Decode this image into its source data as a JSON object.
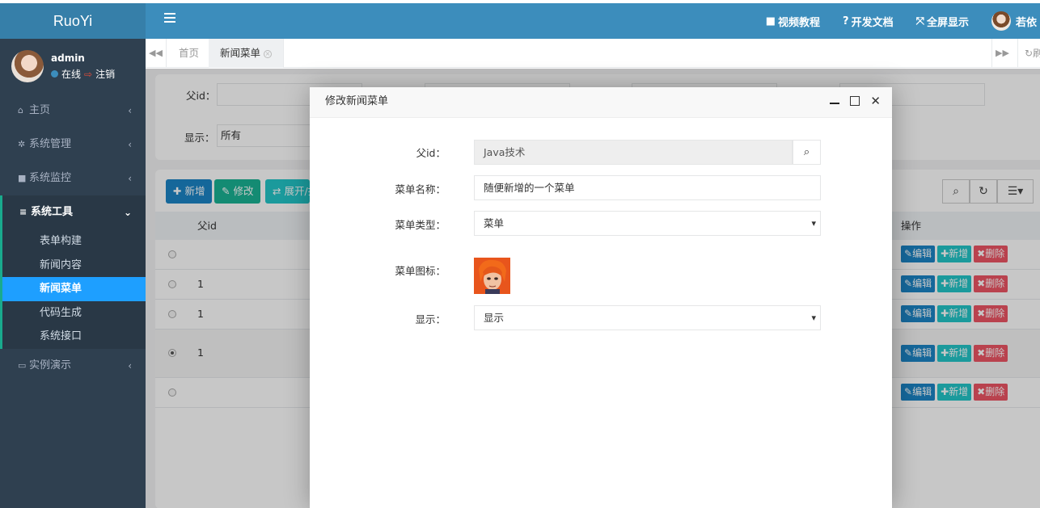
{
  "app": {
    "logo": "RuoYi"
  },
  "user": {
    "name": "admin",
    "status": "在线",
    "logout": "注销"
  },
  "sidebar": {
    "items": [
      {
        "icon": "home-icon",
        "label": "主页"
      },
      {
        "icon": "gear-icon",
        "label": "系统管理"
      },
      {
        "icon": "video-icon",
        "label": "系统监控"
      },
      {
        "icon": "list-icon",
        "label": "系统工具"
      },
      {
        "icon": "desktop-icon",
        "label": "实例演示"
      }
    ],
    "submenu": [
      "表单构建",
      "新闻内容",
      "新闻菜单",
      "代码生成",
      "系统接口"
    ]
  },
  "topbar": {
    "links": [
      {
        "icon": "video-icon",
        "label": "视频教程"
      },
      {
        "icon": "question-icon",
        "label": "开发文档"
      },
      {
        "icon": "fullscreen-icon",
        "label": "全屏显示"
      }
    ],
    "user_label": "若依"
  },
  "tabs": {
    "items": [
      "首页",
      "新闻菜单"
    ],
    "refresh": "刷"
  },
  "search": {
    "parent_id_label": "父id：",
    "show_label": "显示：",
    "show_value": "所有"
  },
  "toolbar": {
    "add": "新增",
    "edit": "修改",
    "expand": "展开/折叠"
  },
  "table": {
    "col_parent_id": "父id",
    "col_actions": "操作",
    "rows": [
      {
        "parent_id": "",
        "checked": false
      },
      {
        "parent_id": "1",
        "checked": false
      },
      {
        "parent_id": "1",
        "checked": false
      },
      {
        "parent_id": "1",
        "checked": true
      },
      {
        "parent_id": "",
        "checked": false
      }
    ],
    "btn_edit": "编辑",
    "btn_add": "新增",
    "btn_delete": "删除"
  },
  "modal": {
    "title": "修改新闻菜单",
    "fields": {
      "parent_id_label": "父id：",
      "parent_id_value": "Java技术",
      "name_label": "菜单名称：",
      "name_value": "随便新增的一个菜单",
      "type_label": "菜单类型：",
      "type_value": "菜单",
      "icon_label": "菜单图标：",
      "show_label": "显示：",
      "show_value": "显示"
    }
  },
  "colors": {
    "topbar": "#3c8dbc",
    "sidebar": "#2f4050",
    "active_submenu": "#1e9fff",
    "primary": "#1c84c6",
    "danger": "#ed5565",
    "info": "#23c6c8"
  }
}
